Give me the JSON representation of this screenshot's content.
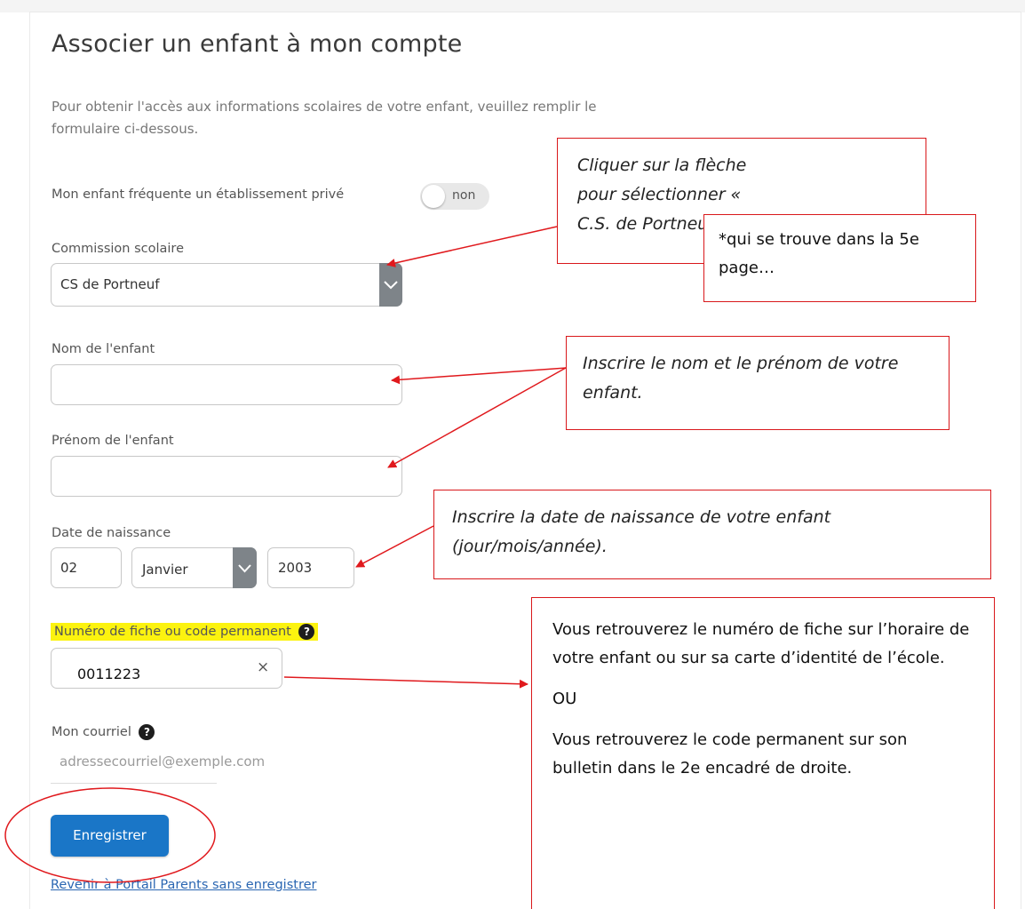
{
  "page": {
    "title": "Associer un enfant à mon compte",
    "intro": "Pour obtenir l'accès aux informations scolaires de votre enfant, veuillez remplir le formulaire ci-dessous."
  },
  "form": {
    "private_school": {
      "label": "Mon enfant fréquente un établissement privé",
      "value": "non"
    },
    "school_board": {
      "label": "Commission scolaire",
      "value": "CS de Portneuf"
    },
    "last_name": {
      "label": "Nom de l'enfant",
      "value": ""
    },
    "first_name": {
      "label": "Prénom de l'enfant",
      "value": ""
    },
    "birth_date": {
      "label": "Date de naissance",
      "day": "02",
      "month": "Janvier",
      "year": "2003"
    },
    "record_number": {
      "label": "Numéro de fiche ou code permanent",
      "value": "0011223",
      "clear": "×",
      "help": "?"
    },
    "email": {
      "label": "Mon courriel",
      "placeholder": "adressecourriel@exemple.com",
      "help": "?"
    },
    "save_label": "Enregistrer",
    "back_link": "Revenir à Portail Parents sans enregistrer"
  },
  "annotations": {
    "select_hint": "Cliquer sur la flèche pour sélectionner « C.S. de Portneuf »",
    "page_note": "*qui se trouve dans la 5e page…",
    "name_hint": "Inscrire le nom et le prénom de votre enfant.",
    "date_hint": "Inscrire la date de naissance de votre enfant (jour/mois/année).",
    "record_hint_1": "Vous retrouverez le numéro de fiche sur l’horaire de votre enfant ou sur sa carte d’identité de l’école.",
    "record_hint_or": "OU",
    "record_hint_2": "Vous retrouverez le code permanent sur son bulletin dans le 2e encadré de droite."
  },
  "colors": {
    "annotation_red": "#d9181b",
    "highlight": "#fcf30f",
    "button_blue": "#1a76c7"
  }
}
